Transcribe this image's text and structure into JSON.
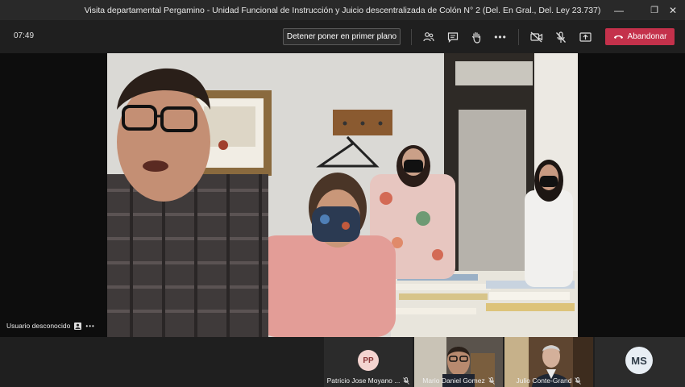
{
  "window": {
    "title": "Visita departamental Pergamino - Unidad Funcional de Instrucción y Juicio descentralizada de Colón N° 2 (Del. En Gral., Del. Ley 23.737)",
    "minimize_glyph": "—",
    "maximize_glyph": "❐",
    "close_glyph": "✕"
  },
  "toolbar": {
    "clock": "07:49",
    "stop_spotlight_label": "Detener poner en primer plano",
    "leave_label": "Abandonar",
    "leave_color": "#c4314b",
    "icons": [
      "participants-icon",
      "chat-icon",
      "raise-hand-icon",
      "more-options-icon",
      "camera-off-icon",
      "mic-off-icon",
      "share-tray-icon",
      "hangup-icon"
    ]
  },
  "main_video": {
    "participant_label": "Usuario desconocido",
    "more_glyph": "•••"
  },
  "participants": [
    {
      "initials": "PP",
      "name": "Patricio Jose Moyano ...",
      "has_video": false,
      "avatar_bg": "#f4d4d0",
      "avatar_fg": "#8b3a3a"
    },
    {
      "initials": "",
      "name": "Mario Daniel Gomez",
      "has_video": true
    },
    {
      "initials": "",
      "name": "Julio Conte-Grand",
      "has_video": true
    },
    {
      "initials": "MS",
      "name": "",
      "has_video": false,
      "avatar_bg": "#e8eef4",
      "avatar_fg": "#2e3a46"
    }
  ]
}
